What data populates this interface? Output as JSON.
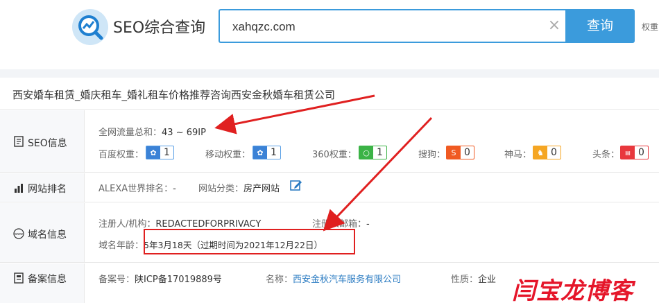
{
  "header": {
    "brand": "SEO综合查询",
    "search_value": "xahqzc.com",
    "clear_glyph": "×",
    "search_button": "查询",
    "weight_link": "权重"
  },
  "site_title": "西安婚车租赁_婚庆租车_婚礼租车价格推荐咨询西安金秋婚车租赁公司",
  "seo": {
    "label": "SEO信息",
    "traffic_label": "全网流量总和：",
    "traffic_value": "43 ~ 69IP",
    "weights": [
      {
        "label": "百度权重：",
        "value": "1",
        "icon": "baidu-paw-icon",
        "color": "#3b82d6"
      },
      {
        "label": "移动权重：",
        "value": "1",
        "icon": "mobile-paw-icon",
        "color": "#3b82d6"
      },
      {
        "label": "360权重：",
        "value": "1",
        "icon": "360-icon",
        "color": "#3bb346"
      },
      {
        "label": "搜狗：",
        "value": "0",
        "icon": "sogou-icon",
        "color": "#f05a22"
      },
      {
        "label": "神马：",
        "value": "0",
        "icon": "shenma-icon",
        "color": "#f5a623"
      },
      {
        "label": "头条：",
        "value": "0",
        "icon": "toutiao-icon",
        "color": "#e8383d"
      }
    ]
  },
  "rank": {
    "label": "网站排名",
    "alexa_label": "ALEXA世界排名：",
    "alexa_value": "-",
    "category_label": "网站分类：",
    "category_value": "房产网站"
  },
  "domain": {
    "label": "域名信息",
    "registrant_label": "注册人/机构：",
    "registrant_value": "REDACTEDFORPRIVACY",
    "email_label": "注册人邮箱：",
    "email_value": "-",
    "age_label": "域名年龄：",
    "age_value": "5年3月18天（过期时间为2021年12月22日）"
  },
  "icp": {
    "label": "备案信息",
    "number_label": "备案号：",
    "number_value": "陕ICP备17019889号",
    "name_label": "名称：",
    "name_value": "西安金秋汽车服务有限公司",
    "nature_label": "性质：",
    "nature_value": "企业"
  },
  "watermark": "闫宝龙博客",
  "colors": {
    "accent": "#3b9bdc",
    "arrow": "#e02020"
  }
}
